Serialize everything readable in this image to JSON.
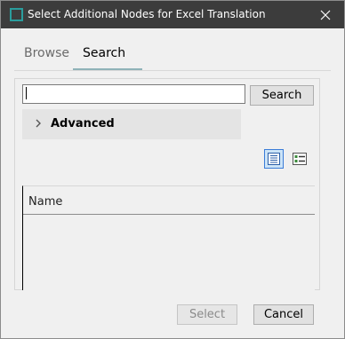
{
  "window": {
    "title": "Select Additional Nodes for Excel Translation",
    "close_icon": "close-icon"
  },
  "tabs": [
    {
      "label": "Browse",
      "active": false
    },
    {
      "label": "Search",
      "active": true
    }
  ],
  "search": {
    "value": "",
    "button_label": "Search"
  },
  "advanced": {
    "label": "Advanced",
    "expanded": false,
    "icon": "chevron-right-icon"
  },
  "view_buttons": {
    "list_icon": "list-view-icon",
    "detail_icon": "detail-view-icon",
    "selected": "list"
  },
  "results": {
    "columns": [
      "Name"
    ]
  },
  "footer": {
    "select_label": "Select",
    "select_enabled": false,
    "cancel_label": "Cancel"
  },
  "colors": {
    "titlebar": "#3c3c3c",
    "accent": "#2a9d9d",
    "tab_underline": "#8fb2b8",
    "selected_view_bg": "#cce4f7"
  }
}
